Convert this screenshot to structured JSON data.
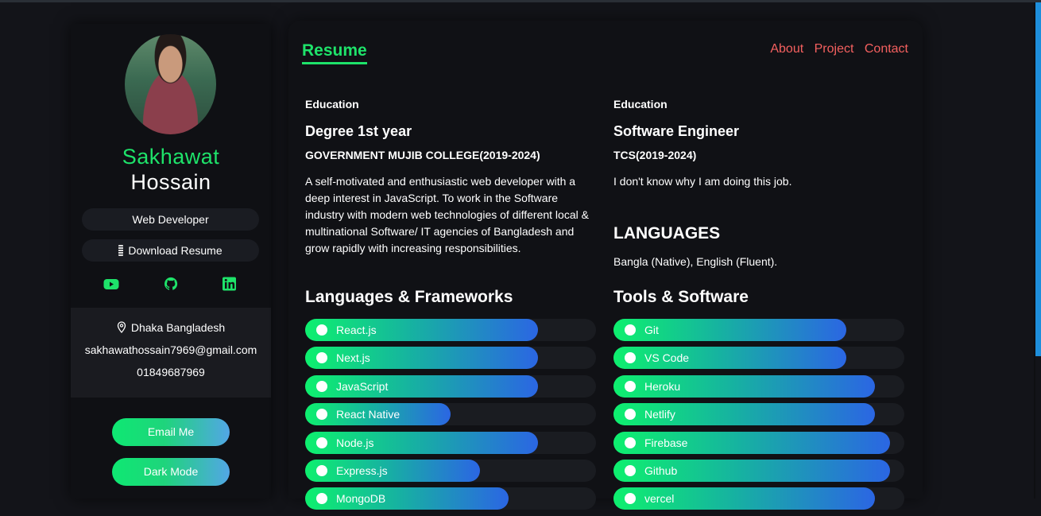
{
  "profile": {
    "first_name": "Sakhawat",
    "last_name": "Hossain",
    "role": "Web Developer",
    "download_label": "Download Resume",
    "location": "Dhaka Bangladesh",
    "email": "sakhawathossain7969@gmail.com",
    "phone": "01849687969",
    "email_button": "Email Me",
    "dark_button": "Dark Mode",
    "socials": [
      "youtube-icon",
      "github-icon",
      "linkedin-icon"
    ]
  },
  "header": {
    "title": "Resume",
    "nav": [
      "About",
      "Project",
      "Contact"
    ]
  },
  "education_left": {
    "label": "Education",
    "degree": "Degree 1st year",
    "institution": "GOVERNMENT MUJIB COLLEGE(2019-2024)",
    "description": "A self-motivated and enthusiastic web developer with a deep interest in JavaScript. To work in the Software industry with modern web technologies of different local & multinational Software/ IT agencies of Bangladesh and grow rapidly with increasing responsibilities."
  },
  "education_right": {
    "label": "Education",
    "degree": "Software Engineer",
    "institution": "TCS(2019-2024)",
    "description": "I don't know why I am doing this job."
  },
  "languages": {
    "heading": "LANGUAGES",
    "text": "Bangla (Native), English (Fluent)."
  },
  "frameworks": {
    "heading": "Languages & Frameworks",
    "items": [
      {
        "label": "React.js",
        "level": 0.8
      },
      {
        "label": "Next.js",
        "level": 0.8
      },
      {
        "label": "JavaScript",
        "level": 0.8
      },
      {
        "label": "React Native",
        "level": 0.5
      },
      {
        "label": "Node.js",
        "level": 0.8
      },
      {
        "label": "Express.js",
        "level": 0.6
      },
      {
        "label": "MongoDB",
        "level": 0.7
      }
    ]
  },
  "tools": {
    "heading": "Tools & Software",
    "items": [
      {
        "label": "Git",
        "level": 0.8
      },
      {
        "label": "VS Code",
        "level": 0.8
      },
      {
        "label": "Heroku",
        "level": 0.9
      },
      {
        "label": "Netlify",
        "level": 0.9
      },
      {
        "label": "Firebase",
        "level": 0.95
      },
      {
        "label": "Github",
        "level": 0.95
      },
      {
        "label": "vercel",
        "level": 0.9
      }
    ]
  },
  "colors": {
    "accent_green": "#1ee36a",
    "nav_link": "#f4605f",
    "background": "#131419",
    "panel": "#101115"
  }
}
